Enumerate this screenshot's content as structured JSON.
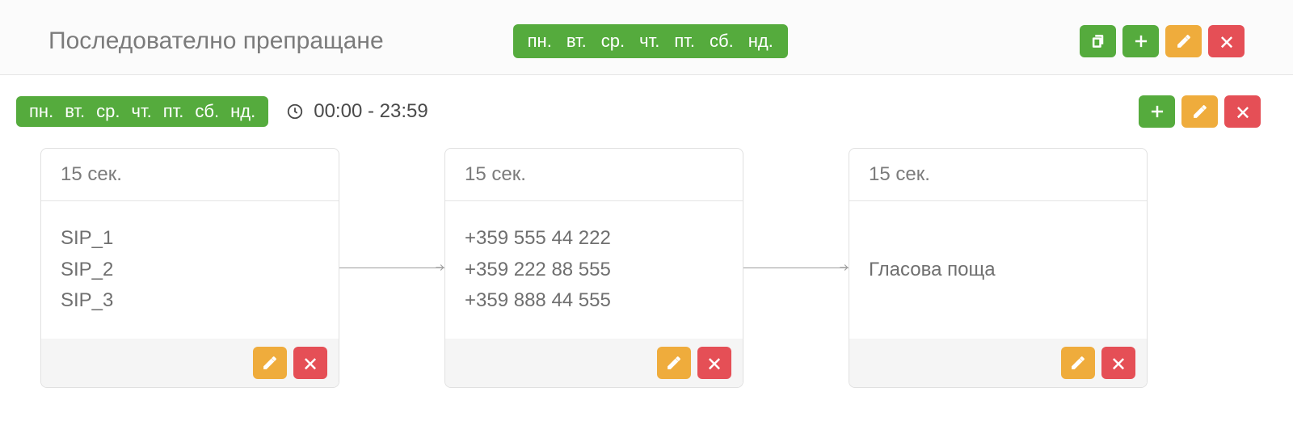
{
  "header": {
    "title": "Последователно препращане",
    "days": [
      "пн.",
      "вт.",
      "ср.",
      "чт.",
      "пт.",
      "сб.",
      "нд."
    ]
  },
  "schedule": {
    "days": [
      "пн.",
      "вт.",
      "ср.",
      "чт.",
      "пт.",
      "сб.",
      "нд."
    ],
    "time_range": "00:00 - 23:59"
  },
  "stages": [
    {
      "duration": "15 сек.",
      "entries": [
        "SIP_1",
        "SIP_2",
        "SIP_3"
      ]
    },
    {
      "duration": "15 сек.",
      "entries": [
        "+359 555 44 222",
        "+359 222 88 555",
        "+359 888 44 555"
      ]
    },
    {
      "duration": "15 сек.",
      "entries": [
        "Гласова поща"
      ]
    }
  ]
}
